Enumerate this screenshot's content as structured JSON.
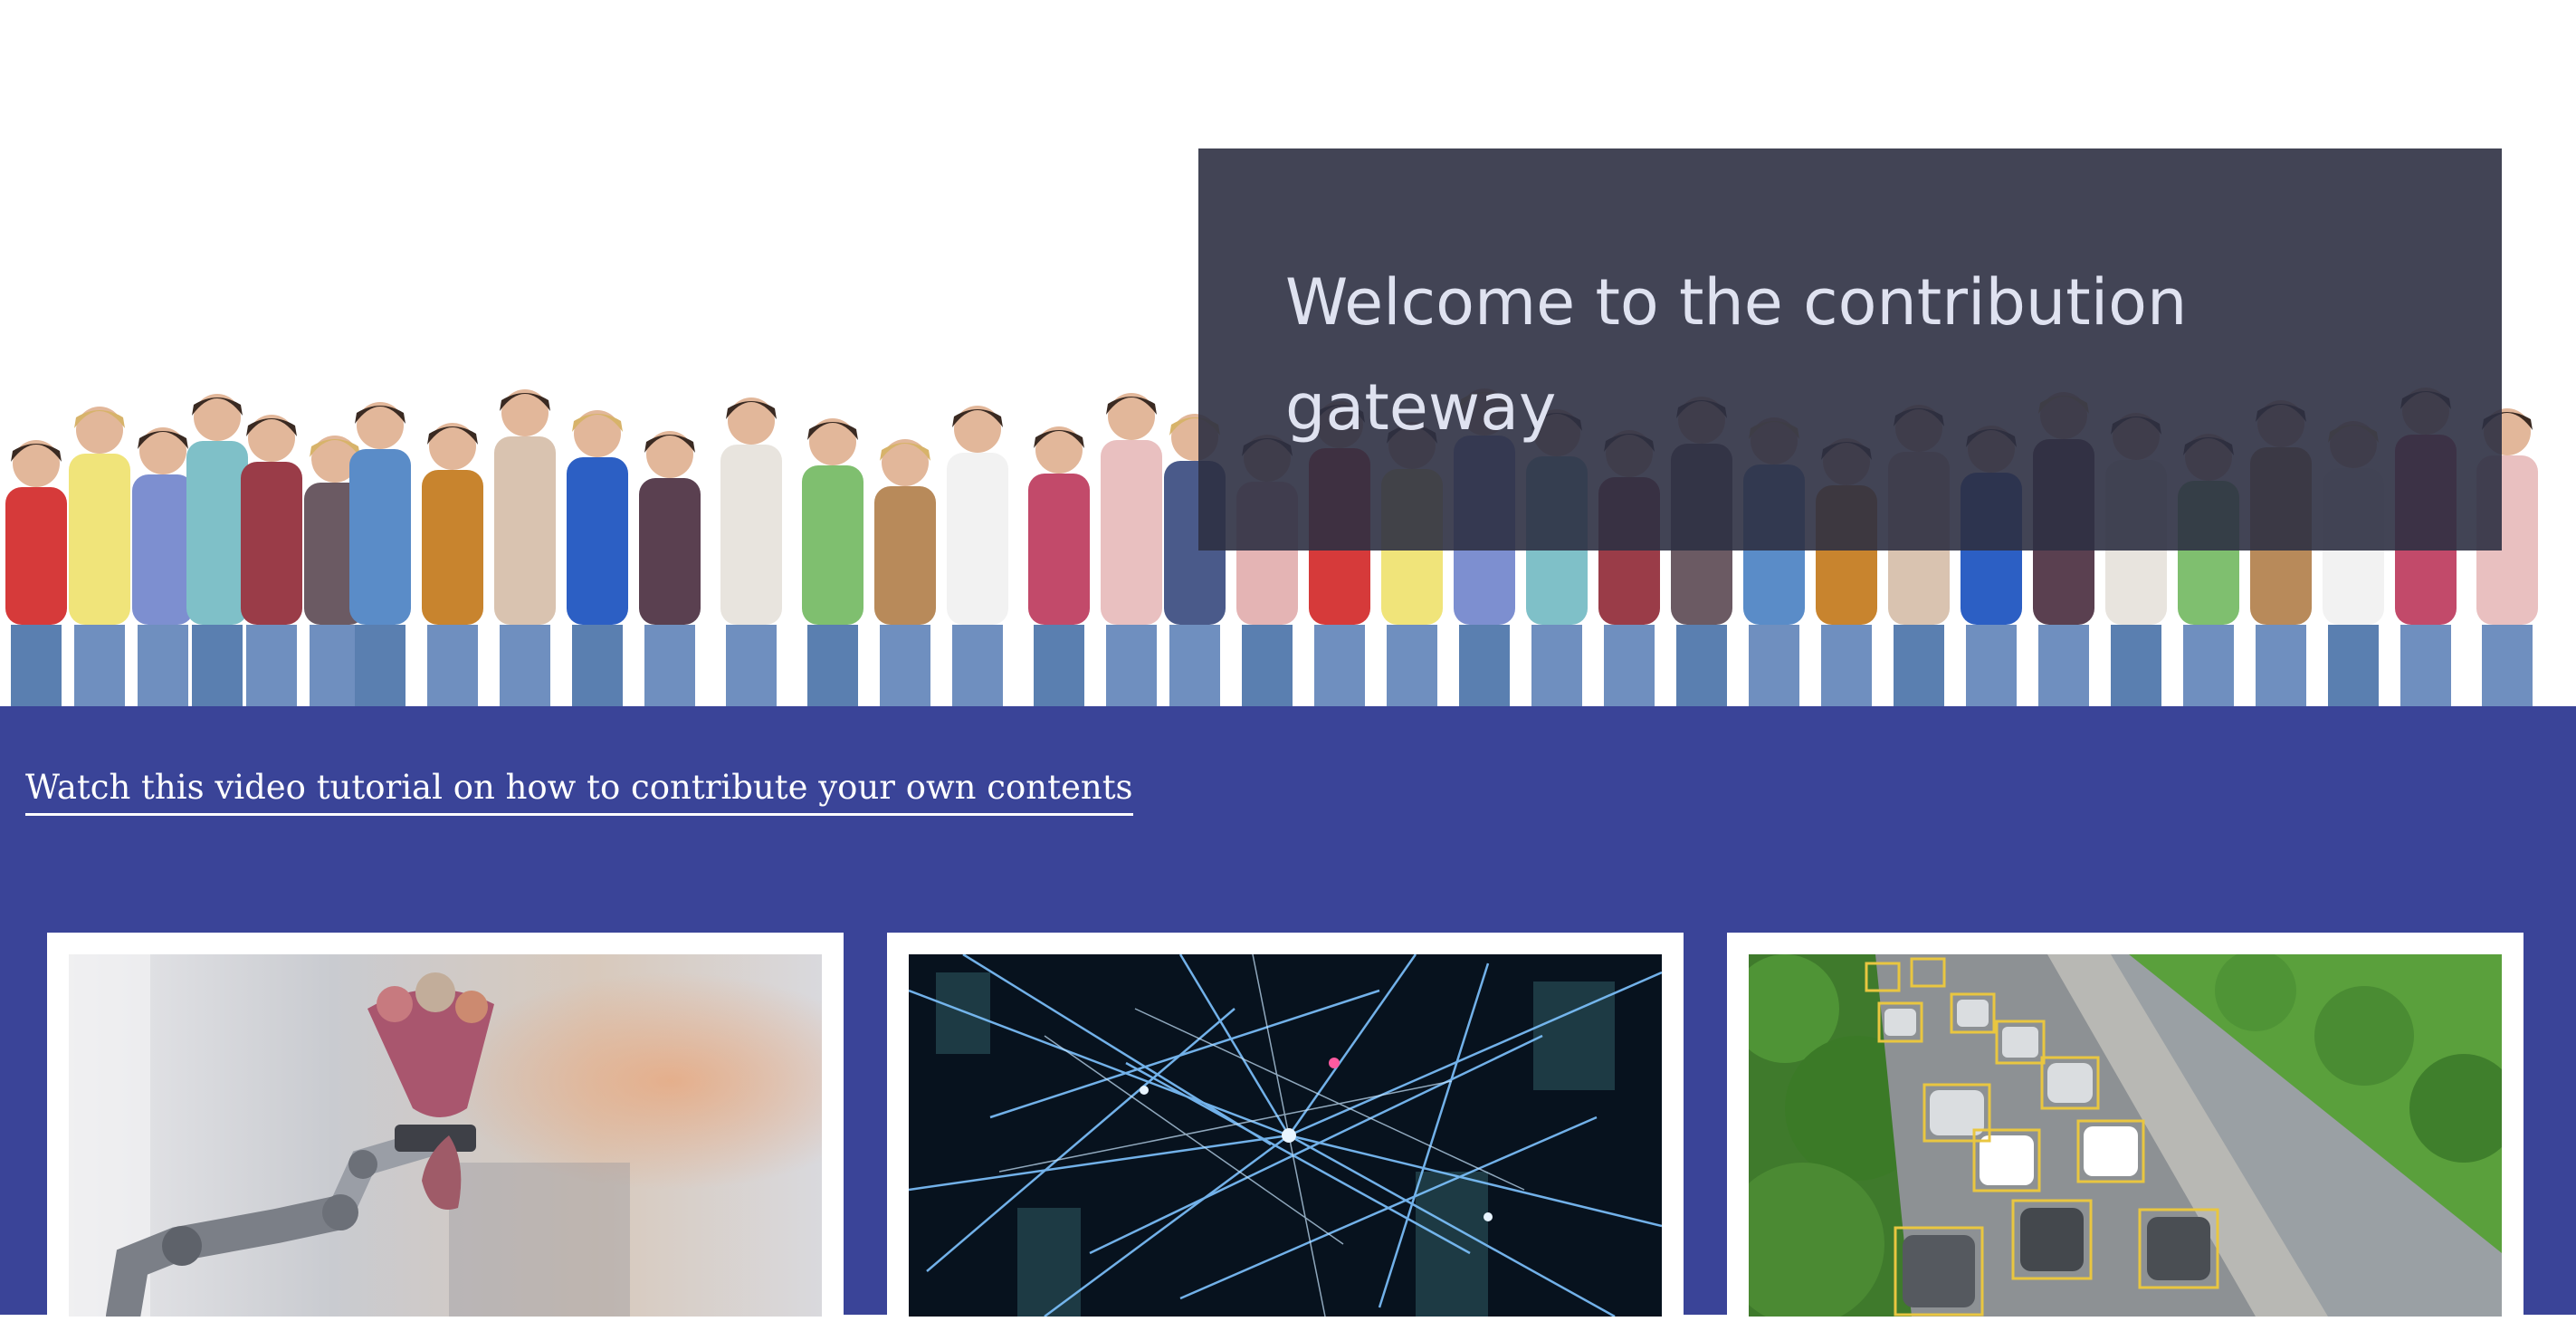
{
  "hero": {
    "title": "Welcome to the contribution gateway"
  },
  "tutorial": {
    "link_text": "Watch this video tutorial on how to contribute your own contents"
  },
  "cards": [
    {
      "name": "robot-arm-flowers-image"
    },
    {
      "name": "network-lines-image"
    },
    {
      "name": "traffic-detection-image"
    }
  ],
  "colors": {
    "band": "#3a4498",
    "overlay": "#2e3042",
    "title": "#dfe2f0",
    "detection_box": "#e9c640"
  }
}
